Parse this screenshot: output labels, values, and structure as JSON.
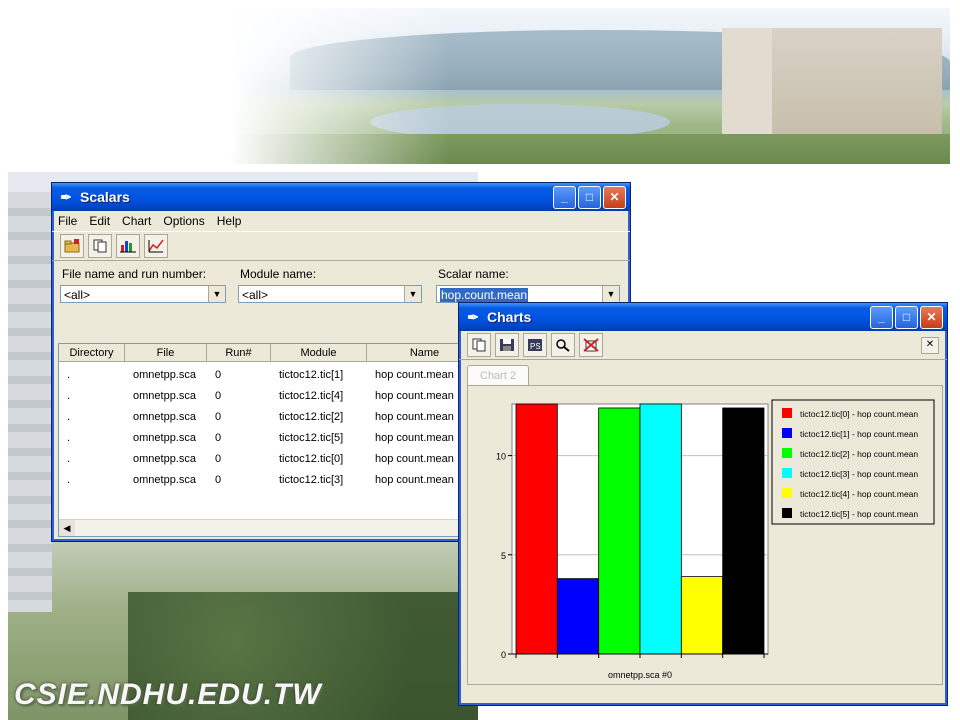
{
  "watermark": "CSIE.NDHU.EDU.TW",
  "scalars": {
    "title": "Scalars",
    "menu": [
      "File",
      "Edit",
      "Chart",
      "Options",
      "Help"
    ],
    "toolbar_icons": [
      "open-folder-icon",
      "copy-icon",
      "bar-chart-icon",
      "line-chart-icon"
    ],
    "filters": {
      "file_label": "File name and run number:",
      "file_value": "<all>",
      "module_label": "Module name:",
      "module_value": "<all>",
      "scalar_label": "Scalar name:",
      "scalar_value": "hop.count.mean"
    },
    "columns": [
      "Directory",
      "File",
      "Run#",
      "Module",
      "Name"
    ],
    "rows": [
      [
        ".",
        "omnetpp.sca",
        "0",
        "tictoc12.tic[1]",
        "hop count.mean"
      ],
      [
        ".",
        "omnetpp.sca",
        "0",
        "tictoc12.tic[4]",
        "hop count.mean"
      ],
      [
        ".",
        "omnetpp.sca",
        "0",
        "tictoc12.tic[2]",
        "hop count.mean"
      ],
      [
        ".",
        "omnetpp.sca",
        "0",
        "tictoc12.tic[5]",
        "hop count.mean"
      ],
      [
        ".",
        "omnetpp.sca",
        "0",
        "tictoc12.tic[0]",
        "hop count.mean"
      ],
      [
        ".",
        "omnetpp.sca",
        "0",
        "tictoc12.tic[3]",
        "hop count.mean"
      ]
    ]
  },
  "charts": {
    "title": "Charts",
    "toolbar_icons": [
      "copy-icon",
      "save-icon",
      "save-ps-icon",
      "zoom-icon",
      "delete-icon"
    ],
    "tab_label": "Chart 2"
  },
  "chart_data": {
    "type": "bar",
    "categories": [
      "omnetpp.sca #0"
    ],
    "series": [
      {
        "name": "tictoc12.tic[0] - hop count.mean",
        "values": [
          12.6
        ],
        "color": "#ff0000"
      },
      {
        "name": "tictoc12.tic[1] - hop count.mean",
        "values": [
          3.8
        ],
        "color": "#0000ff"
      },
      {
        "name": "tictoc12.tic[2] - hop count.mean",
        "values": [
          12.4
        ],
        "color": "#00ff00"
      },
      {
        "name": "tictoc12.tic[3] - hop count.mean",
        "values": [
          12.6
        ],
        "color": "#00ffff"
      },
      {
        "name": "tictoc12.tic[4] - hop count.mean",
        "values": [
          3.9
        ],
        "color": "#ffff00"
      },
      {
        "name": "tictoc12.tic[5] - hop count.mean",
        "values": [
          12.4
        ],
        "color": "#000000"
      }
    ],
    "yticks": [
      0,
      5,
      10
    ],
    "ylim": [
      0,
      12.6
    ],
    "grid": true,
    "legend": "right"
  }
}
